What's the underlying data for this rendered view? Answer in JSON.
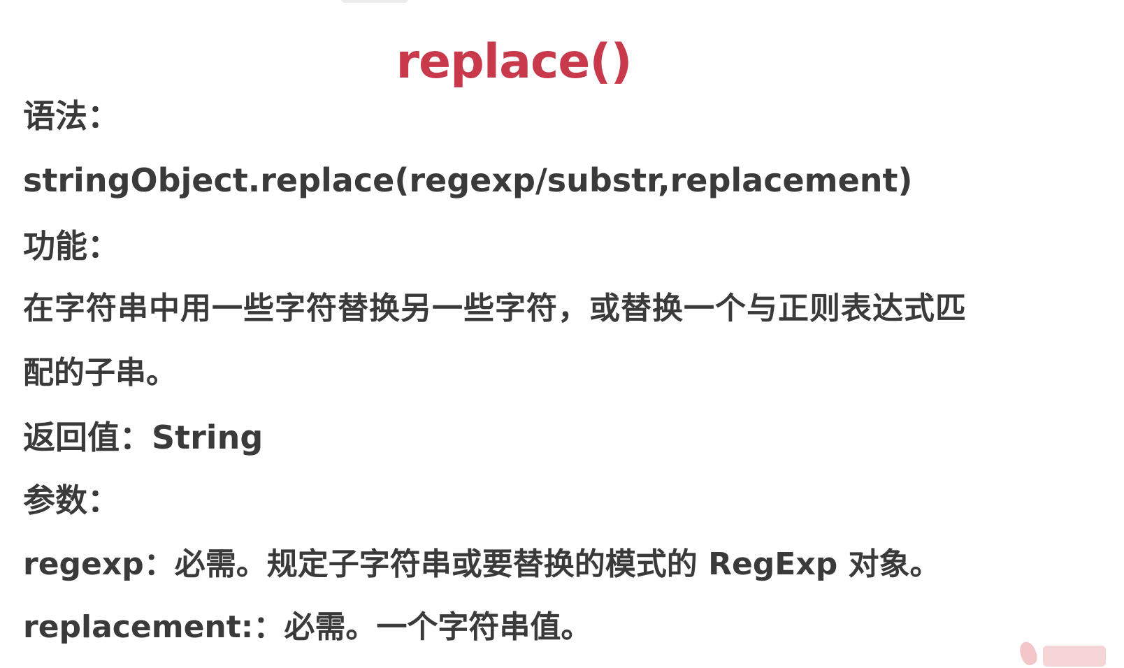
{
  "title": "replace()",
  "lines": {
    "syntax_label": "语法：",
    "syntax_code": "stringObject.replace(regexp/substr,replacement)",
    "function_label": "功能：",
    "function_desc_1": "在字符串中用一些字符替换另一些字符，或替换一个与正则表达式匹",
    "function_desc_2": "配的子串。",
    "return_value": "返回值：String",
    "params_label": "参数：",
    "param_regexp": "regexp：必需。规定子字符串或要替换的模式的 RegExp 对象。",
    "param_replacement": "replacement:：必需。一个字符串值。"
  },
  "colors": {
    "title": "#c9394c",
    "text": "#3a3a3a"
  },
  "icons": {
    "logo": "flame-logo-icon"
  }
}
